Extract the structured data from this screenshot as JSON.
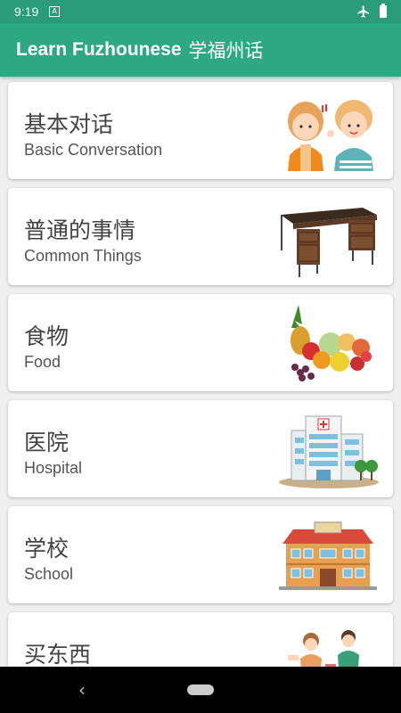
{
  "status_bar": {
    "time": "9:19",
    "sim_icon": "A"
  },
  "app_bar": {
    "title_en": "Learn Fuzhounese",
    "title_cn": "学福州话"
  },
  "categories": [
    {
      "cn": "基本对话",
      "en": "Basic Conversation",
      "icon": "two-people-talking-icon"
    },
    {
      "cn": "普通的事情",
      "en": "Common Things",
      "icon": "desk-icon"
    },
    {
      "cn": "食物",
      "en": "Food",
      "icon": "fruit-pile-icon"
    },
    {
      "cn": "医院",
      "en": "Hospital",
      "icon": "hospital-building-icon"
    },
    {
      "cn": "学校",
      "en": "School",
      "icon": "school-building-icon"
    },
    {
      "cn": "买东西",
      "en": "",
      "icon": "shopping-people-icon"
    }
  ],
  "colors": {
    "primary": "#2ea882",
    "primary_dark": "#2a9d78",
    "card": "#ffffff",
    "background": "#efefef"
  }
}
